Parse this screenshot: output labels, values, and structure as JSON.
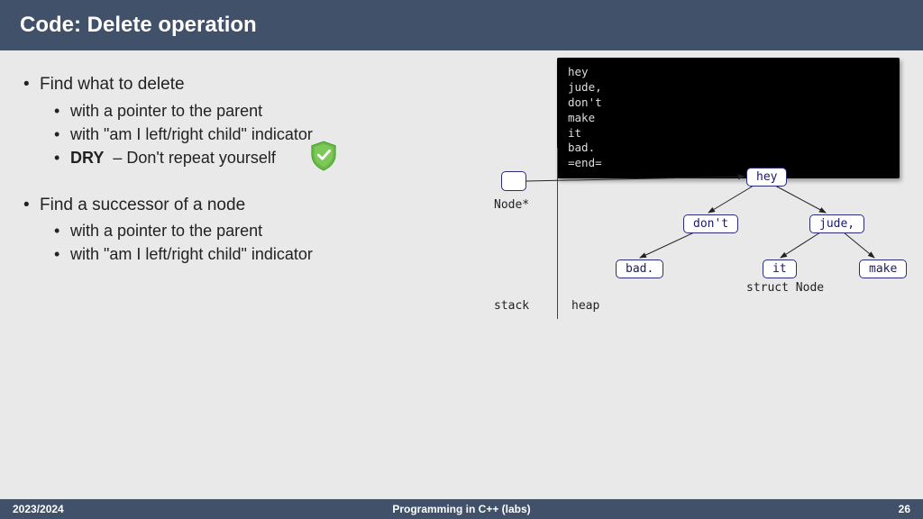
{
  "header": {
    "title": "Code: Delete operation"
  },
  "footer": {
    "year": "2023/2024",
    "course": "Programming in C++ (labs)",
    "page": "26"
  },
  "bullets": {
    "b1": "Find what to delete",
    "b1a": "with a pointer to the parent",
    "b1b": "with \"am I left/right child\" indicator",
    "b1c_strong": "DRY",
    "b1c_rest": " – Don't repeat yourself",
    "b2": "Find a successor of a node",
    "b2a": "with a pointer to the parent",
    "b2b": "with \"am I left/right child\" indicator"
  },
  "terminal": [
    "hey",
    "jude,",
    "don't",
    "make",
    "it",
    "bad.",
    "=end="
  ],
  "diagram": {
    "nodeptr": "Node*",
    "stack": "stack",
    "heap": "heap",
    "struct": "struct Node",
    "nodes": {
      "hey": "hey",
      "dont": "don't",
      "jude": "jude,",
      "bad": "bad.",
      "it": "it",
      "make": "make"
    }
  }
}
